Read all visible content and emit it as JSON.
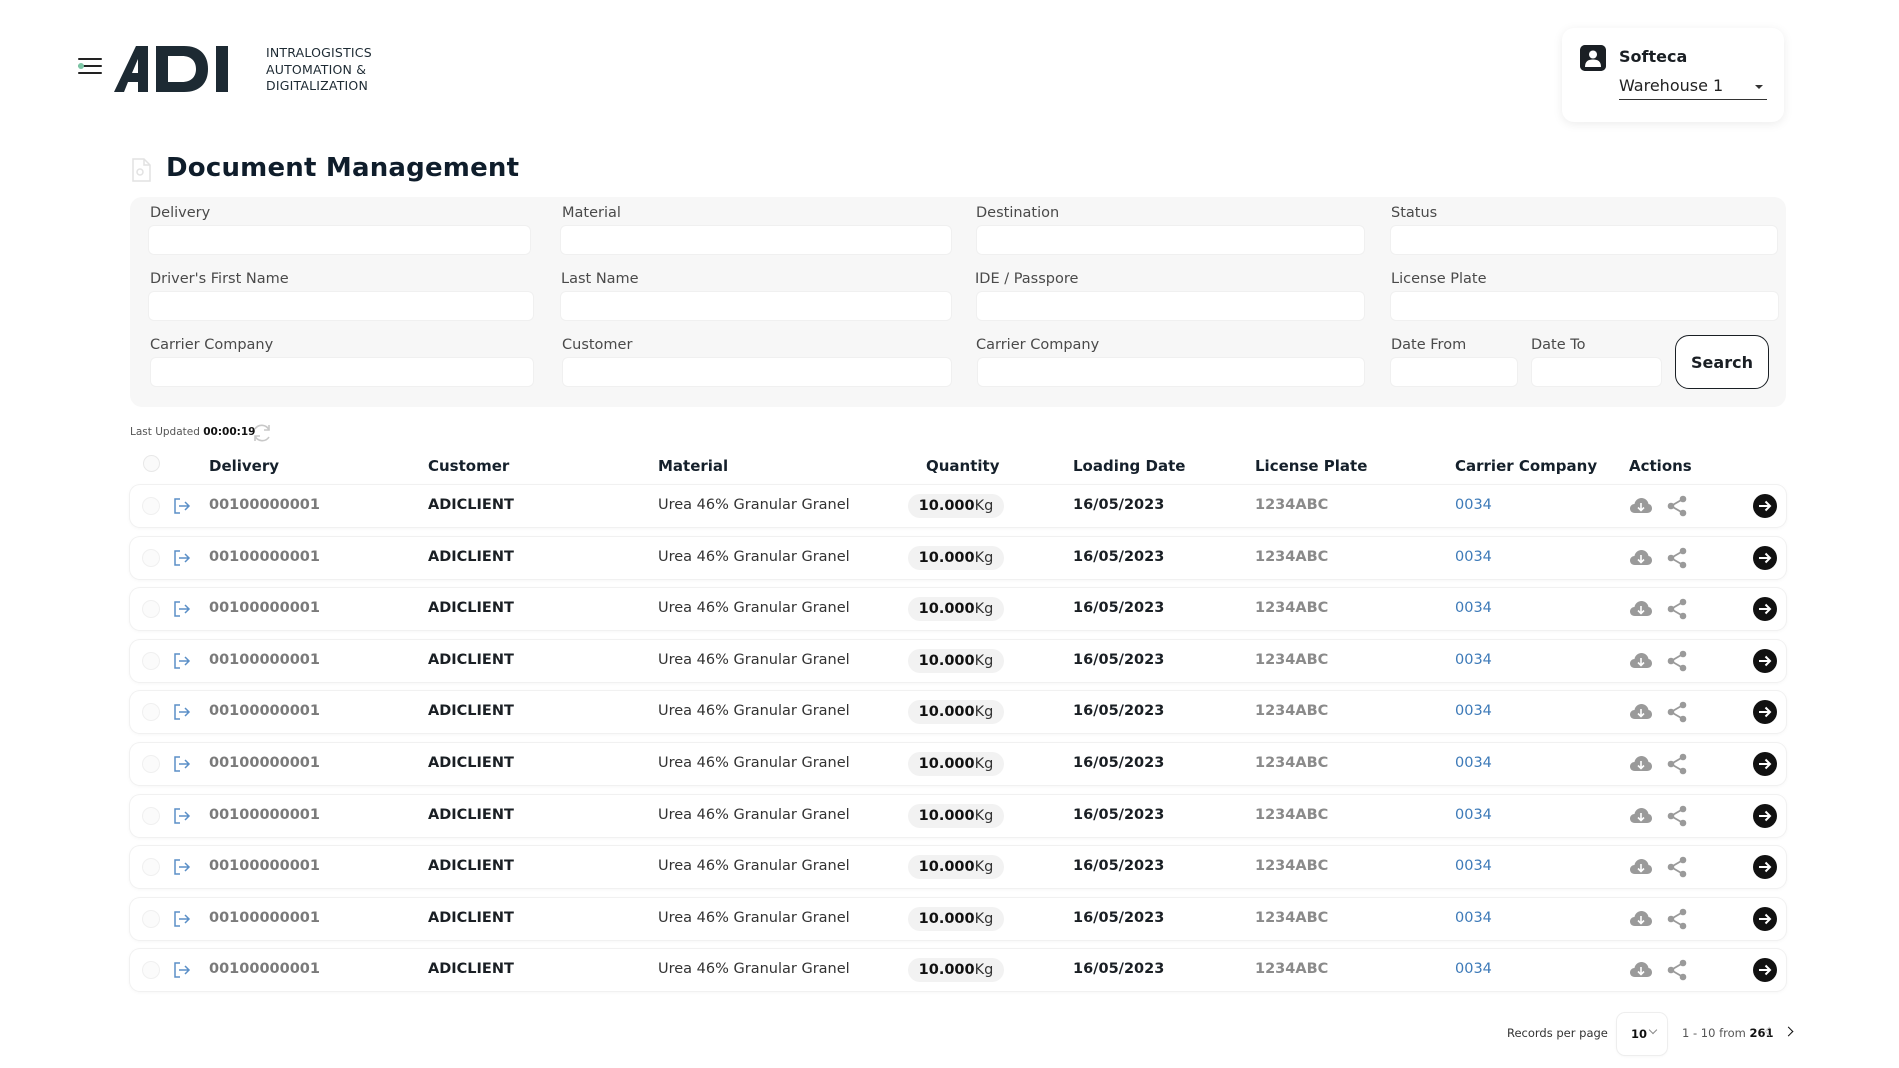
{
  "header": {
    "logo_text": "ADI",
    "tagline": [
      "INTRALOGISTICS",
      "AUTOMATION &",
      "DIGITALIZATION"
    ],
    "account": {
      "name": "Softeca",
      "warehouse": "Warehouse 1"
    }
  },
  "page_title": "Document Management",
  "filters": {
    "delivery": "Delivery",
    "material": "Material",
    "destination": "Destination",
    "status": "Status",
    "driver_first_name": "Driver's First Name",
    "last_name": "Last Name",
    "ide_passport": "IDE /  Passpore",
    "license_plate": "License Plate",
    "carrier_company_1": "Carrier Company",
    "customer": "Customer",
    "carrier_company_2": "Carrier Company",
    "date_from": "Date From",
    "date_to": "Date To",
    "search_button": "Search"
  },
  "last_updated": {
    "label": "Last Updated",
    "time": "00:00:19"
  },
  "table": {
    "columns": [
      "Delivery",
      "Customer",
      "Material",
      "Quantity",
      "Loading Date",
      "License Plate",
      "Carrier Company",
      "Actions"
    ],
    "rows": [
      {
        "delivery": "00100000001",
        "customer": "ADICLIENT",
        "material": "Urea 46% Granular Granel",
        "qty": "10.000",
        "unit": "Kg",
        "date": "16/05/2023",
        "plate": "1234ABC",
        "carrier": "0034"
      },
      {
        "delivery": "00100000001",
        "customer": "ADICLIENT",
        "material": "Urea 46% Granular Granel",
        "qty": "10.000",
        "unit": "Kg",
        "date": "16/05/2023",
        "plate": "1234ABC",
        "carrier": "0034"
      },
      {
        "delivery": "00100000001",
        "customer": "ADICLIENT",
        "material": "Urea 46% Granular Granel",
        "qty": "10.000",
        "unit": "Kg",
        "date": "16/05/2023",
        "plate": "1234ABC",
        "carrier": "0034"
      },
      {
        "delivery": "00100000001",
        "customer": "ADICLIENT",
        "material": "Urea 46% Granular Granel",
        "qty": "10.000",
        "unit": "Kg",
        "date": "16/05/2023",
        "plate": "1234ABC",
        "carrier": "0034"
      },
      {
        "delivery": "00100000001",
        "customer": "ADICLIENT",
        "material": "Urea 46% Granular Granel",
        "qty": "10.000",
        "unit": "Kg",
        "date": "16/05/2023",
        "plate": "1234ABC",
        "carrier": "0034"
      },
      {
        "delivery": "00100000001",
        "customer": "ADICLIENT",
        "material": "Urea 46% Granular Granel",
        "qty": "10.000",
        "unit": "Kg",
        "date": "16/05/2023",
        "plate": "1234ABC",
        "carrier": "0034"
      },
      {
        "delivery": "00100000001",
        "customer": "ADICLIENT",
        "material": "Urea 46% Granular Granel",
        "qty": "10.000",
        "unit": "Kg",
        "date": "16/05/2023",
        "plate": "1234ABC",
        "carrier": "0034"
      },
      {
        "delivery": "00100000001",
        "customer": "ADICLIENT",
        "material": "Urea 46% Granular Granel",
        "qty": "10.000",
        "unit": "Kg",
        "date": "16/05/2023",
        "plate": "1234ABC",
        "carrier": "0034"
      },
      {
        "delivery": "00100000001",
        "customer": "ADICLIENT",
        "material": "Urea 46% Granular Granel",
        "qty": "10.000",
        "unit": "Kg",
        "date": "16/05/2023",
        "plate": "1234ABC",
        "carrier": "0034"
      },
      {
        "delivery": "00100000001",
        "customer": "ADICLIENT",
        "material": "Urea 46% Granular Granel",
        "qty": "10.000",
        "unit": "Kg",
        "date": "16/05/2023",
        "plate": "1234ABC",
        "carrier": "0034"
      }
    ]
  },
  "pagination": {
    "records_per_page_label": "Records per page",
    "records_per_page": "10",
    "range": "1 - 10 from",
    "total": "261"
  },
  "icons": {
    "menu": "hamburger-menu-icon",
    "account": "user-badge-icon",
    "title": "document-icon",
    "refresh": "refresh-icon",
    "row_exit": "exit-arrow-icon",
    "download": "cloud-download-icon",
    "share": "share-icon",
    "go": "arrow-right-circle-icon"
  },
  "colors": {
    "accent_link": "#3d7ab8",
    "dark": "#1a1f24",
    "panel_bg": "#f7f7f7"
  }
}
